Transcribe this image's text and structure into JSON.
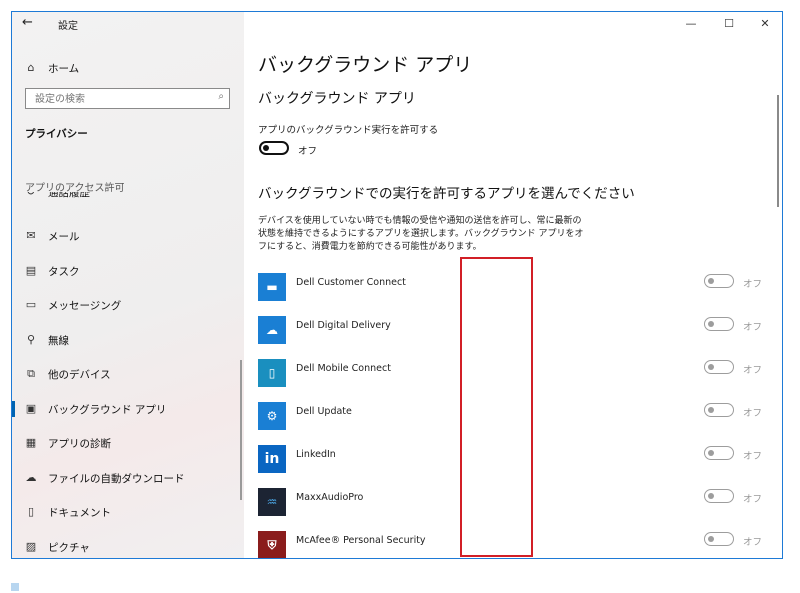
{
  "window": {
    "back_glyph": "←",
    "title": "設定",
    "minimize_glyph": "—",
    "maximize_glyph": "☐",
    "close_glyph": "✕"
  },
  "sidebar": {
    "home_label": "ホーム",
    "search_placeholder": "設定の検索",
    "section_title": "プライバシー",
    "group_label": "アプリのアクセス許可",
    "partial_item_label": "通話履歴",
    "items": [
      {
        "label": "メール",
        "icon": "mail-icon",
        "glyph": "✉"
      },
      {
        "label": "タスク",
        "icon": "tasks-icon",
        "glyph": "▤"
      },
      {
        "label": "メッセージング",
        "icon": "messaging-icon",
        "glyph": "▭"
      },
      {
        "label": "無線",
        "icon": "radios-icon",
        "glyph": "⚲"
      },
      {
        "label": "他のデバイス",
        "icon": "other-devices-icon",
        "glyph": "⧉"
      },
      {
        "label": "バックグラウンド アプリ",
        "icon": "background-apps-icon",
        "glyph": "▣"
      },
      {
        "label": "アプリの診断",
        "icon": "app-diagnostics-icon",
        "glyph": "▦"
      },
      {
        "label": "ファイルの自動ダウンロード",
        "icon": "cloud-icon",
        "glyph": "☁"
      },
      {
        "label": "ドキュメント",
        "icon": "documents-icon",
        "glyph": "▯"
      },
      {
        "label": "ピクチャ",
        "icon": "pictures-icon",
        "glyph": "▨"
      }
    ]
  },
  "main": {
    "page_title": "バックグラウンド アプリ",
    "subheading": "バックグラウンド アプリ",
    "allow_label": "アプリのバックグラウンド実行を許可する",
    "allow_state": "オフ",
    "choose_heading": "バックグラウンドでの実行を許可するアプリを選んでください",
    "description": "デバイスを使用していない時でも情報の受信や通知の送信を許可し、常に最新の状態を維持できるようにするアプリを選択します。バックグラウンド アプリをオフにすると、消費電力を節約できる可能性があります。",
    "apps": [
      {
        "name": "Dell Customer Connect",
        "state": "オフ",
        "color": "#1a7fd4",
        "glyph": "▬"
      },
      {
        "name": "Dell Digital Delivery",
        "state": "オフ",
        "color": "#1a7fd4",
        "glyph": "☁"
      },
      {
        "name": "Dell Mobile Connect",
        "state": "オフ",
        "color": "#1a8fbf",
        "glyph": "▯"
      },
      {
        "name": "Dell Update",
        "state": "オフ",
        "color": "#1a7fd4",
        "glyph": "⚙"
      },
      {
        "name": "LinkedIn",
        "state": "オフ",
        "color": "#0a66c2",
        "glyph": "in"
      },
      {
        "name": "MaxxAudioPro",
        "state": "オフ",
        "color": "#1c2433",
        "glyph": "♒"
      },
      {
        "name": "McAfee® Personal Security",
        "state": "オフ",
        "color": "#8a1c1c",
        "glyph": "⛨"
      }
    ]
  },
  "colors": {
    "accent": "#0063b1",
    "highlight_border": "#d21f26",
    "window_border": "#1e7ad6"
  }
}
